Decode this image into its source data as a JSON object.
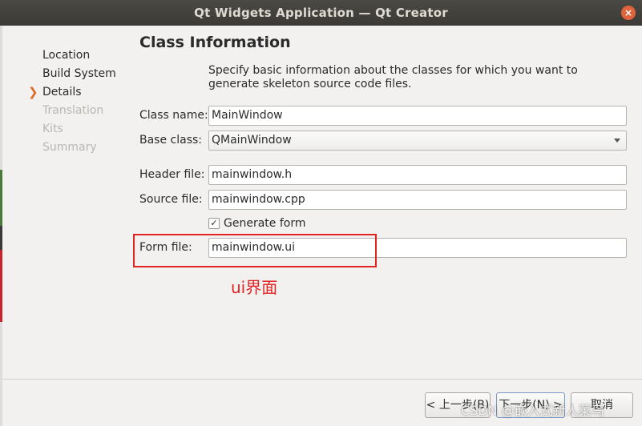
{
  "window": {
    "title": "Qt Widgets Application — Qt Creator",
    "close_glyph": "×"
  },
  "nav": {
    "current_marker": "❯",
    "items": [
      {
        "label": "Location",
        "state": "done"
      },
      {
        "label": "Build System",
        "state": "done"
      },
      {
        "label": "Details",
        "state": "current"
      },
      {
        "label": "Translation",
        "state": "disabled"
      },
      {
        "label": "Kits",
        "state": "disabled"
      },
      {
        "label": "Summary",
        "state": "disabled"
      }
    ]
  },
  "page": {
    "title": "Class Information",
    "description": "Specify basic information about the classes for which you want to generate skeleton source code files."
  },
  "form": {
    "class_name_label": "Class name:",
    "class_name_value": "MainWindow",
    "base_class_label": "Base class:",
    "base_class_value": "QMainWindow",
    "header_file_label": "Header file:",
    "header_file_value": "mainwindow.h",
    "source_file_label": "Source file:",
    "source_file_value": "mainwindow.cpp",
    "generate_form_label": "Generate form",
    "generate_form_checked": true,
    "check_glyph": "✓",
    "form_file_label": "Form file:",
    "form_file_value": "mainwindow.ui"
  },
  "annotation": {
    "text": "ui界面",
    "color": "#e02424"
  },
  "buttons": {
    "back": "< 上一步(B)",
    "next": "下一步(N) >",
    "cancel": "取消"
  },
  "watermark": "CSDN @嵌入式新人菜鸟",
  "colors": {
    "titlebar": "#3b3a36",
    "accent_arrow": "#e06a27",
    "highlight": "#e02424"
  }
}
